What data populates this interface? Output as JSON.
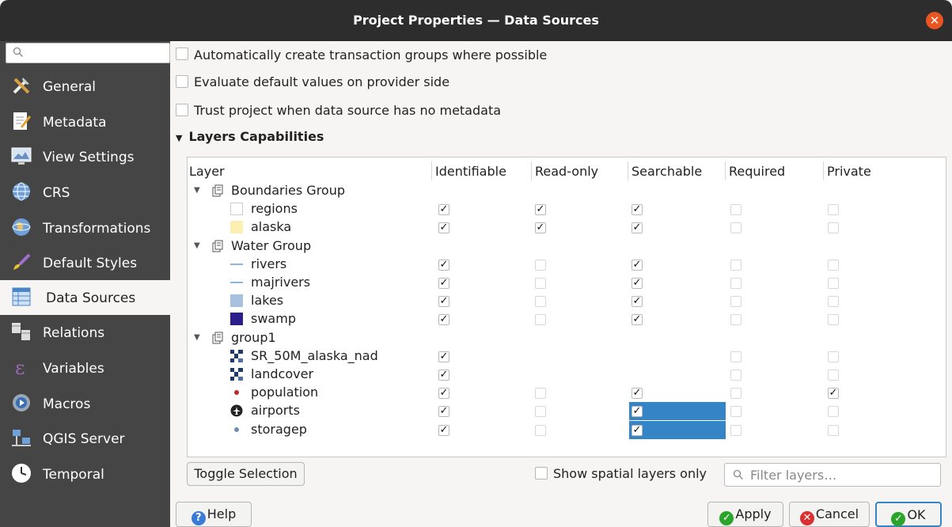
{
  "window": {
    "title": "Project Properties — Data Sources"
  },
  "sidebar": {
    "search_placeholder": "",
    "items": [
      {
        "label": "General",
        "icon": "tools-icon"
      },
      {
        "label": "Metadata",
        "icon": "document-edit-icon"
      },
      {
        "label": "View Settings",
        "icon": "monitor-icon"
      },
      {
        "label": "CRS",
        "icon": "globe-icon"
      },
      {
        "label": "Transformations",
        "icon": "transform-globe-icon"
      },
      {
        "label": "Default Styles",
        "icon": "paint-brush-icon"
      },
      {
        "label": "Data Sources",
        "icon": "table-icon",
        "active": true
      },
      {
        "label": "Relations",
        "icon": "relations-icon"
      },
      {
        "label": "Variables",
        "icon": "epsilon-icon"
      },
      {
        "label": "Macros",
        "icon": "gear-play-icon"
      },
      {
        "label": "QGIS Server",
        "icon": "server-icon"
      },
      {
        "label": "Temporal",
        "icon": "clock-icon"
      }
    ]
  },
  "options": [
    {
      "label": "Automatically create transaction groups where possible",
      "checked": false
    },
    {
      "label": "Evaluate default values on provider side",
      "checked": false
    },
    {
      "label": "Trust project when data source has no metadata",
      "checked": false
    }
  ],
  "section": {
    "label": "Layers Capabilities"
  },
  "table": {
    "columns": [
      "Layer",
      "Identifiable",
      "Read-only",
      "Searchable",
      "Required",
      "Private"
    ],
    "groups": [
      "Boundaries Group",
      "Water Group",
      "group1"
    ],
    "layers": [
      {
        "name": "regions",
        "group": 0,
        "icon": "polygon-white",
        "identifiable": true,
        "readonly": true,
        "searchable": true,
        "required": false,
        "private": false
      },
      {
        "name": "alaska",
        "group": 0,
        "icon": "polygon-cream",
        "identifiable": true,
        "readonly": true,
        "searchable": true,
        "required": false,
        "private": false
      },
      {
        "name": "rivers",
        "group": 1,
        "icon": "line",
        "identifiable": true,
        "readonly": false,
        "searchable": true,
        "required": false,
        "private": false
      },
      {
        "name": "majrivers",
        "group": 1,
        "icon": "line",
        "identifiable": true,
        "readonly": false,
        "searchable": true,
        "required": false,
        "private": false
      },
      {
        "name": "lakes",
        "group": 1,
        "icon": "polygon-lightblue",
        "identifiable": true,
        "readonly": false,
        "searchable": true,
        "required": false,
        "private": false
      },
      {
        "name": "swamp",
        "group": 1,
        "icon": "polygon-navy",
        "identifiable": true,
        "readonly": false,
        "searchable": true,
        "required": false,
        "private": false
      },
      {
        "name": "SR_50M_alaska_nad",
        "group": 2,
        "icon": "raster",
        "identifiable": true,
        "readonly": null,
        "searchable": null,
        "required": false,
        "private": false
      },
      {
        "name": "landcover",
        "group": 2,
        "icon": "raster",
        "identifiable": true,
        "readonly": null,
        "searchable": null,
        "required": false,
        "private": false
      },
      {
        "name": "population",
        "group": 2,
        "icon": "point-red",
        "identifiable": true,
        "readonly": false,
        "searchable": true,
        "required": false,
        "private": true
      },
      {
        "name": "airports",
        "group": 2,
        "icon": "point-plane",
        "identifiable": true,
        "readonly": false,
        "searchable": true,
        "required": false,
        "private": false,
        "selected": true
      },
      {
        "name": "storagep",
        "group": 2,
        "icon": "point-gray",
        "identifiable": true,
        "readonly": false,
        "searchable": true,
        "required": false,
        "private": false,
        "selected": true
      }
    ]
  },
  "toolbar": {
    "toggle_selection": "Toggle Selection",
    "show_spatial_label": "Show spatial layers only",
    "filter_placeholder": "Filter layers…"
  },
  "footer": {
    "help": "Help",
    "apply": "Apply",
    "cancel": "Cancel",
    "ok": "OK"
  },
  "colors": {
    "titlebar": "#2d2d2d",
    "sidebar": "#454545",
    "accent": "#e95420",
    "selection": "#3584c5"
  }
}
